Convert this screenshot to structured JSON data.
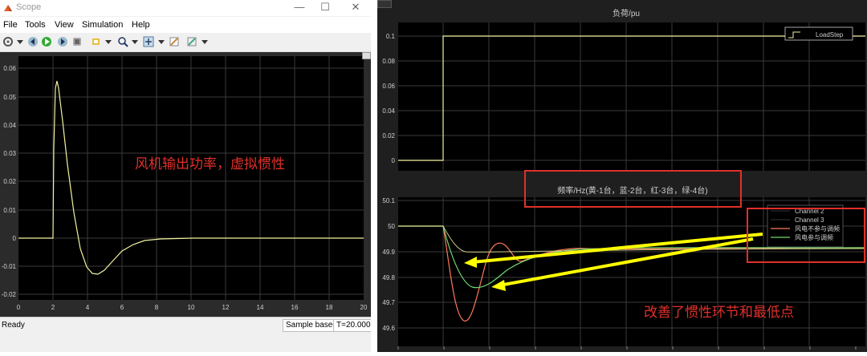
{
  "window": {
    "title": "Scope",
    "menu": [
      "File",
      "Tools",
      "View",
      "Simulation",
      "Help"
    ]
  },
  "left_plot": {
    "annotation": "风机输出功率，虚拟惯性",
    "y_ticks": [
      "0.06",
      "0.05",
      "0.04",
      "0.03",
      "0.02",
      "0.01",
      "0",
      "-0.01",
      "-0.02"
    ],
    "x_ticks": [
      "0",
      "2",
      "4",
      "6",
      "8",
      "10",
      "12",
      "14",
      "16",
      "18",
      "20"
    ]
  },
  "status": {
    "ready": "Ready",
    "sample": "Sample based",
    "time": "T=20.000"
  },
  "right_top": {
    "title": "负荷/pu",
    "legend": "LoadStep",
    "y_ticks": [
      "0.1",
      "0.08",
      "0.06",
      "0.04",
      "0.02",
      "0"
    ]
  },
  "right_bottom": {
    "title": "频率/Hz(黄-1台，蓝-2台，红-3台，绿-4台)",
    "legend": [
      "Channel 2",
      "Channel 3",
      "风电不参与调频",
      "风电参与调频"
    ],
    "y_ticks": [
      "50.1",
      "50",
      "49.9",
      "49.8",
      "49.7",
      "49.6"
    ],
    "annotation": "改善了惯性环节和最低点"
  },
  "colors": {
    "trace_yellow": "#f2f2a0",
    "trace_red": "#ff7a5a",
    "trace_green": "#6fd86f",
    "annotation_red": "#e0302a"
  }
}
